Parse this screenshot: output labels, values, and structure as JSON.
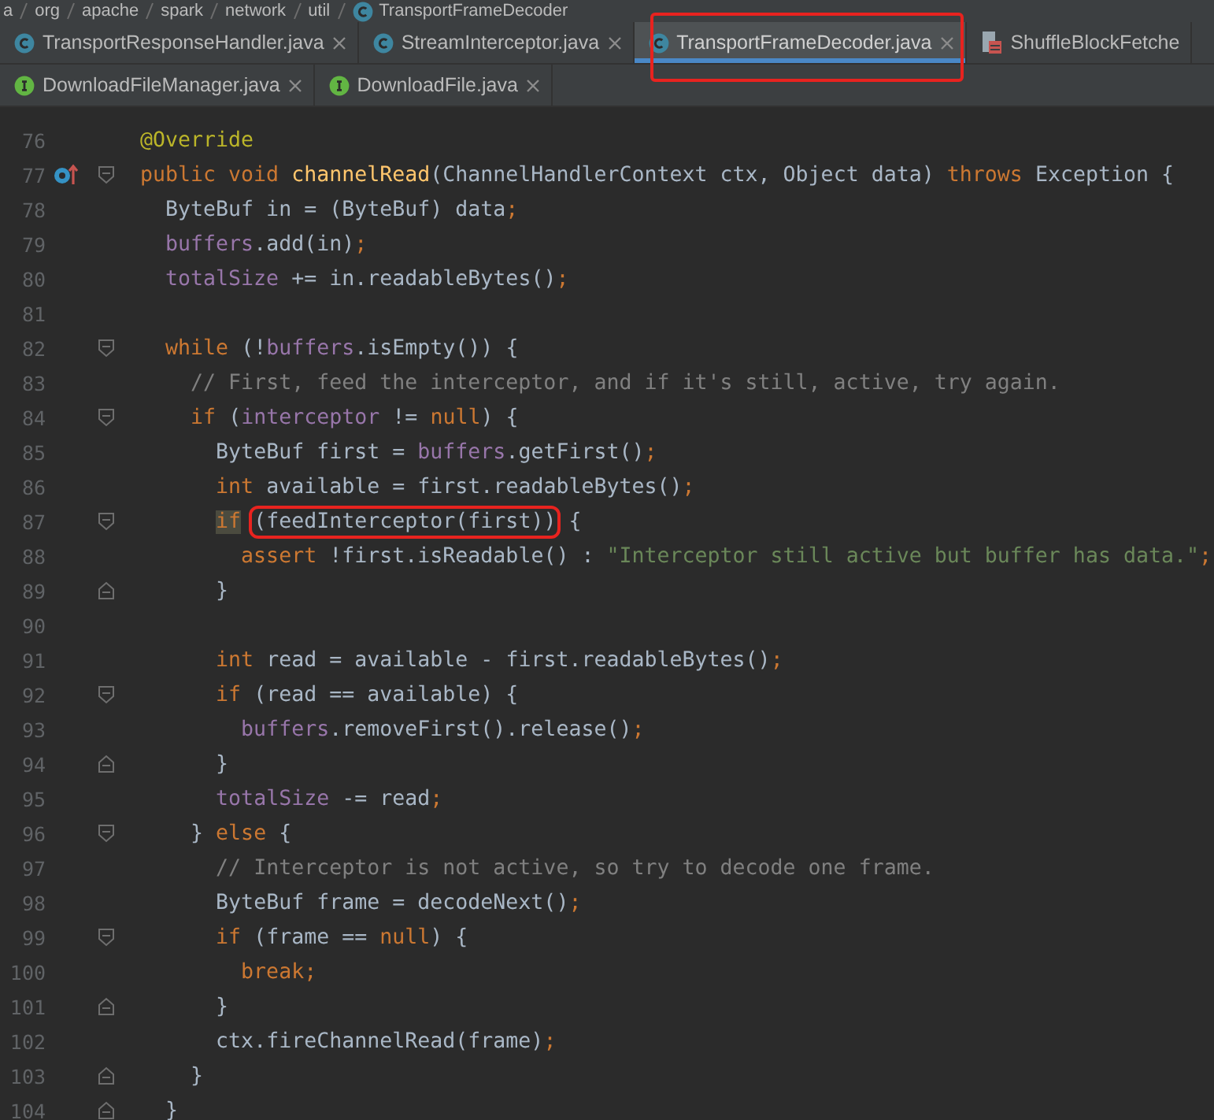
{
  "breadcrumb": [
    {
      "label": "a",
      "kind": "package"
    },
    {
      "label": "org",
      "kind": "package"
    },
    {
      "label": "apache",
      "kind": "package"
    },
    {
      "label": "spark",
      "kind": "package"
    },
    {
      "label": "network",
      "kind": "package"
    },
    {
      "label": "util",
      "kind": "package"
    },
    {
      "label": "TransportFrameDecoder",
      "kind": "class"
    }
  ],
  "tab_rows": [
    [
      {
        "label": "TransportResponseHandler.java",
        "kind": "class",
        "selected": false,
        "closable": true,
        "boxed": false
      },
      {
        "label": "StreamInterceptor.java",
        "kind": "class",
        "selected": false,
        "closable": true,
        "boxed": false
      },
      {
        "label": "TransportFrameDecoder.java",
        "kind": "class",
        "selected": true,
        "closable": true,
        "boxed": true
      },
      {
        "label": "ShuffleBlockFetche",
        "kind": "test",
        "selected": false,
        "closable": false,
        "boxed": false
      }
    ],
    [
      {
        "label": "DownloadFileManager.java",
        "kind": "interface",
        "selected": false,
        "closable": true,
        "boxed": false
      },
      {
        "label": "DownloadFile.java",
        "kind": "interface",
        "selected": false,
        "closable": true,
        "boxed": false
      }
    ]
  ],
  "editor": {
    "lines": [
      {
        "number": "76",
        "fold_open": false,
        "fold_close": false,
        "override": false,
        "tokens": [
          {
            "t": "@Override",
            "kind": "annotation"
          }
        ]
      },
      {
        "number": "77",
        "fold_open": true,
        "fold_close": false,
        "override": true,
        "tokens": [
          {
            "t": "public void ",
            "kind": "keyword"
          },
          {
            "t": "channelRead",
            "kind": "method"
          },
          {
            "t": "(ChannelHandlerContext ctx, Object data) ",
            "kind": "plain"
          },
          {
            "t": "throws",
            "kind": "keyword"
          },
          {
            "t": " Exception {",
            "kind": "plain"
          }
        ]
      },
      {
        "number": "78",
        "fold_open": false,
        "fold_close": false,
        "override": false,
        "tokens": [
          {
            "t": "  ByteBuf in = (ByteBuf) data",
            "kind": "plain"
          },
          {
            "t": ";",
            "kind": "keyword"
          }
        ]
      },
      {
        "number": "79",
        "fold_open": false,
        "fold_close": false,
        "override": false,
        "tokens": [
          {
            "t": "  buffers",
            "kind": "field"
          },
          {
            "t": ".add(in)",
            "kind": "plain"
          },
          {
            "t": ";",
            "kind": "keyword"
          }
        ]
      },
      {
        "number": "80",
        "fold_open": false,
        "fold_close": false,
        "override": false,
        "tokens": [
          {
            "t": "  totalSize",
            "kind": "field"
          },
          {
            "t": " += in.readableBytes()",
            "kind": "plain"
          },
          {
            "t": ";",
            "kind": "keyword"
          }
        ]
      },
      {
        "number": "81",
        "fold_open": false,
        "fold_close": false,
        "override": false
      },
      {
        "number": "82",
        "fold_open": true,
        "fold_close": false,
        "override": false,
        "tokens": [
          {
            "t": "  while",
            "kind": "keyword"
          },
          {
            "t": " (!",
            "kind": "plain"
          },
          {
            "t": "buffers",
            "kind": "field"
          },
          {
            "t": ".isEmpty()) {",
            "kind": "plain"
          }
        ]
      },
      {
        "number": "83",
        "fold_open": false,
        "fold_close": false,
        "override": false,
        "tokens": [
          {
            "t": "    // First, feed the interceptor, and if it's still, active, try again.",
            "kind": "comment"
          }
        ]
      },
      {
        "number": "84",
        "fold_open": true,
        "fold_close": false,
        "override": false,
        "tokens": [
          {
            "t": "    if",
            "kind": "keyword"
          },
          {
            "t": " (",
            "kind": "plain"
          },
          {
            "t": "interceptor",
            "kind": "field"
          },
          {
            "t": " != ",
            "kind": "plain"
          },
          {
            "t": "null",
            "kind": "keyword"
          },
          {
            "t": ") {",
            "kind": "plain"
          }
        ]
      },
      {
        "number": "85",
        "fold_open": false,
        "fold_close": false,
        "override": false,
        "tokens": [
          {
            "t": "      ByteBuf first = ",
            "kind": "plain"
          },
          {
            "t": "buffers",
            "kind": "field"
          },
          {
            "t": ".getFirst()",
            "kind": "plain"
          },
          {
            "t": ";",
            "kind": "keyword"
          }
        ]
      },
      {
        "number": "86",
        "fold_open": false,
        "fold_close": false,
        "override": false,
        "tokens": [
          {
            "t": "      int",
            "kind": "keyword"
          },
          {
            "t": " available = first.readableBytes()",
            "kind": "plain"
          },
          {
            "t": ";",
            "kind": "keyword"
          }
        ]
      },
      {
        "number": "87",
        "fold_open": true,
        "fold_close": false,
        "override": false,
        "tokens": [
          {
            "t": "      if",
            "kind": "keyword",
            "highlighted": true,
            "boxed": false
          },
          {
            "t": " (feedInterceptor(first))",
            "kind": "plain",
            "highlighted": false,
            "boxed": true
          },
          {
            "t": " {",
            "kind": "plain"
          }
        ]
      },
      {
        "number": "88",
        "fold_open": false,
        "fold_close": false,
        "override": false,
        "tokens": [
          {
            "t": "        assert",
            "kind": "keyword"
          },
          {
            "t": " !first.isReadable() : ",
            "kind": "plain"
          },
          {
            "t": "\"Interceptor still active but buffer has data.\"",
            "kind": "string"
          },
          {
            "t": ";",
            "kind": "keyword"
          }
        ]
      },
      {
        "number": "89",
        "fold_open": false,
        "fold_close": true,
        "override": false,
        "tokens": [
          {
            "t": "      }",
            "kind": "plain"
          }
        ]
      },
      {
        "number": "90",
        "fold_open": false,
        "fold_close": false,
        "override": false
      },
      {
        "number": "91",
        "fold_open": false,
        "fold_close": false,
        "override": false,
        "tokens": [
          {
            "t": "      int",
            "kind": "keyword"
          },
          {
            "t": " read = available - first.readableBytes()",
            "kind": "plain"
          },
          {
            "t": ";",
            "kind": "keyword"
          }
        ]
      },
      {
        "number": "92",
        "fold_open": true,
        "fold_close": false,
        "override": false,
        "tokens": [
          {
            "t": "      if",
            "kind": "keyword"
          },
          {
            "t": " (read == available) {",
            "kind": "plain"
          }
        ]
      },
      {
        "number": "93",
        "fold_open": false,
        "fold_close": false,
        "override": false,
        "tokens": [
          {
            "t": "        buffers",
            "kind": "field"
          },
          {
            "t": ".removeFirst().release()",
            "kind": "plain"
          },
          {
            "t": ";",
            "kind": "keyword"
          }
        ]
      },
      {
        "number": "94",
        "fold_open": false,
        "fold_close": true,
        "override": false,
        "tokens": [
          {
            "t": "      }",
            "kind": "plain"
          }
        ]
      },
      {
        "number": "95",
        "fold_open": false,
        "fold_close": false,
        "override": false,
        "tokens": [
          {
            "t": "      totalSize",
            "kind": "field"
          },
          {
            "t": " -= read",
            "kind": "plain"
          },
          {
            "t": ";",
            "kind": "keyword"
          }
        ]
      },
      {
        "number": "96",
        "fold_open": true,
        "fold_close": false,
        "override": false,
        "tokens": [
          {
            "t": "    } ",
            "kind": "plain"
          },
          {
            "t": "else",
            "kind": "keyword"
          },
          {
            "t": " {",
            "kind": "plain"
          }
        ]
      },
      {
        "number": "97",
        "fold_open": false,
        "fold_close": false,
        "override": false,
        "tokens": [
          {
            "t": "      // Interceptor is not active, so try to decode one frame.",
            "kind": "comment"
          }
        ]
      },
      {
        "number": "98",
        "fold_open": false,
        "fold_close": false,
        "override": false,
        "tokens": [
          {
            "t": "      ByteBuf frame = decodeNext()",
            "kind": "plain"
          },
          {
            "t": ";",
            "kind": "keyword"
          }
        ]
      },
      {
        "number": "99",
        "fold_open": true,
        "fold_close": false,
        "override": false,
        "tokens": [
          {
            "t": "      if",
            "kind": "keyword"
          },
          {
            "t": " (frame == ",
            "kind": "plain"
          },
          {
            "t": "null",
            "kind": "keyword"
          },
          {
            "t": ") {",
            "kind": "plain"
          }
        ]
      },
      {
        "number": "100",
        "fold_open": false,
        "fold_close": false,
        "override": false,
        "tokens": [
          {
            "t": "        break;",
            "kind": "keyword"
          }
        ]
      },
      {
        "number": "101",
        "fold_open": false,
        "fold_close": true,
        "override": false,
        "tokens": [
          {
            "t": "      }",
            "kind": "plain"
          }
        ]
      },
      {
        "number": "102",
        "fold_open": false,
        "fold_close": false,
        "override": false,
        "tokens": [
          {
            "t": "      ctx.fireChannelRead(frame)",
            "kind": "plain"
          },
          {
            "t": ";",
            "kind": "keyword"
          }
        ]
      },
      {
        "number": "103",
        "fold_open": false,
        "fold_close": true,
        "override": false,
        "tokens": [
          {
            "t": "    }",
            "kind": "plain"
          }
        ]
      },
      {
        "number": "104",
        "fold_open": false,
        "fold_close": true,
        "override": false,
        "tokens": [
          {
            "t": "  }",
            "kind": "plain"
          }
        ]
      }
    ]
  }
}
